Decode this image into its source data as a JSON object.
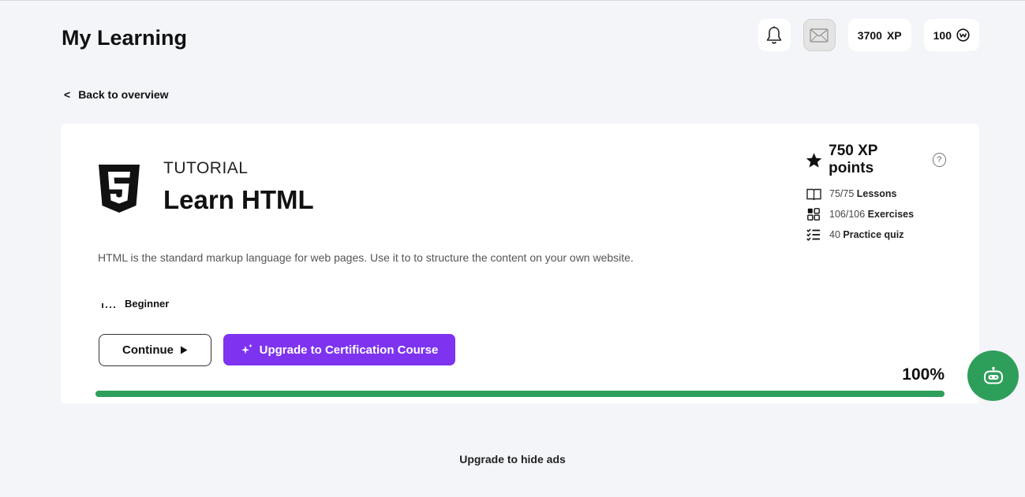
{
  "header": {
    "title": "My Learning",
    "xp": {
      "value": "3700",
      "unit": "XP"
    },
    "coins": "100"
  },
  "nav": {
    "back_arrow": "<",
    "back_label": "Back to overview"
  },
  "course": {
    "type": "TUTORIAL",
    "name": "Learn HTML",
    "logo_icon": "html5-icon",
    "description": "HTML is the standard markup language for web pages. Use it to to structure the content on your own website.",
    "level": "Beginner",
    "xp_points": "750 XP points",
    "help": "?",
    "stats": [
      {
        "icon": "book-icon",
        "count": "75/75",
        "label": "Lessons"
      },
      {
        "icon": "exercises-icon",
        "count": "106/106",
        "label": "Exercises"
      },
      {
        "icon": "checklist-icon",
        "count": "40",
        "label": "Practice quiz"
      }
    ],
    "continue_label": "Continue",
    "upgrade_label": "Upgrade to Certification Course",
    "progress_label": "100%",
    "progress": 1.0
  },
  "footer": {
    "upgrade_ads": "Upgrade to hide ads"
  },
  "colors": {
    "accent_purple": "#7d33f0",
    "progress_green": "#2e9e5b"
  }
}
